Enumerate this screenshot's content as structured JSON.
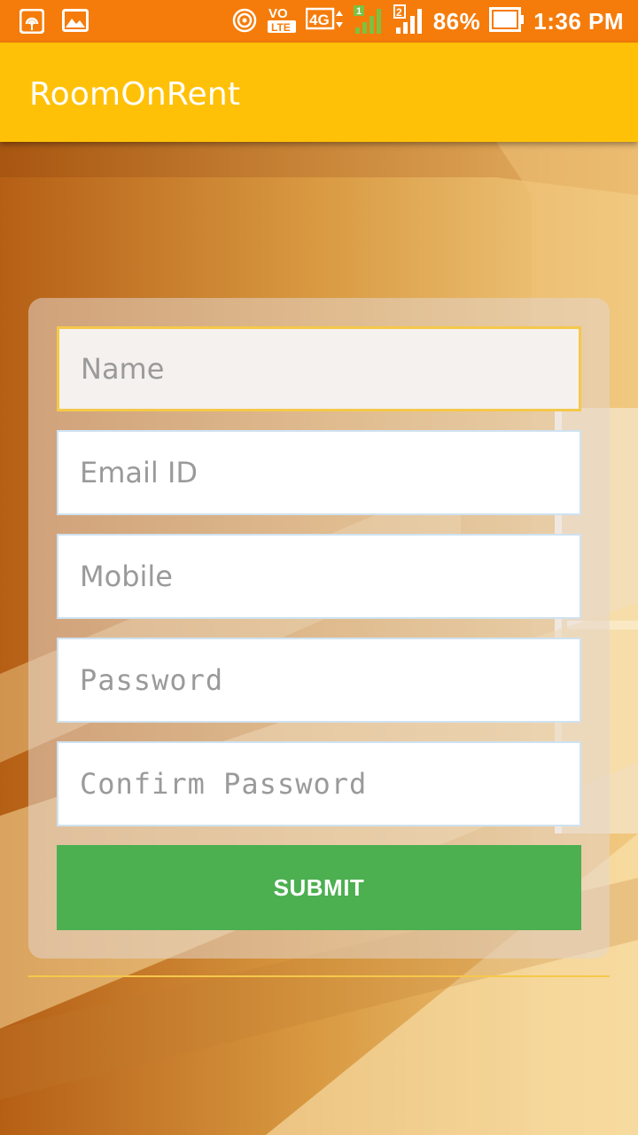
{
  "status_bar": {
    "battery_percent": "86%",
    "time": "1:36 PM",
    "network_type": "4G",
    "volte": "VO",
    "lte": "LTE",
    "sim1": "1",
    "sim2": "2",
    "left_icons": [
      "hotspot-icon",
      "image-icon"
    ],
    "right_icons": [
      "wifi-hotspot-icon",
      "volte-icon",
      "4g-icon",
      "signal-sim1-icon",
      "signal-sim2-icon",
      "battery-icon"
    ]
  },
  "app_bar": {
    "title": "RoomOnRent"
  },
  "form": {
    "name_placeholder": "Name",
    "email_placeholder": "Email ID",
    "mobile_placeholder": "Mobile",
    "password_placeholder": "Password",
    "confirm_password_placeholder": "Confirm Password",
    "submit_label": "SUBMIT"
  },
  "colors": {
    "status_bar": "#f57c0b",
    "app_bar": "#ffc107",
    "submit_button": "#4caf50",
    "focus_border": "#f5c84a"
  }
}
